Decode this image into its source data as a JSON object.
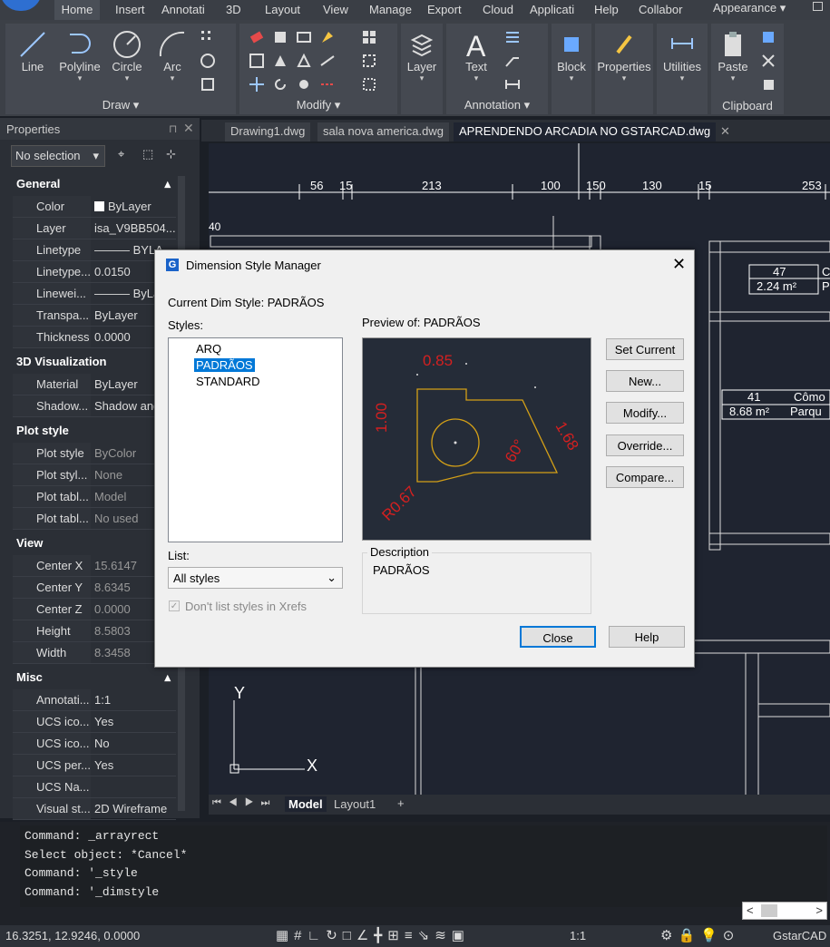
{
  "menu": {
    "tabs": [
      "Home",
      "Insert",
      "Annotati",
      "3D",
      "Layout",
      "View",
      "Manage",
      "Export",
      "Cloud",
      "Applicati",
      "Help",
      "Collabor"
    ],
    "appearance": "Appearance"
  },
  "ribbon": {
    "draw": {
      "title": "Draw",
      "buttons": [
        "Line",
        "Polyline",
        "Circle",
        "Arc"
      ]
    },
    "modify": {
      "title": "Modify"
    },
    "layer": "Layer",
    "annotation": {
      "title": "Annotation",
      "text": "Text"
    },
    "block": "Block",
    "properties": "Properties",
    "utilities": "Utilities",
    "clipboard": {
      "title": "Clipboard",
      "paste": "Paste"
    }
  },
  "properties": {
    "title": "Properties",
    "selection": "No selection",
    "sections": {
      "general": "General",
      "viz": "3D Visualization",
      "plot": "Plot style",
      "view": "View",
      "misc": "Misc"
    },
    "general": [
      {
        "k": "Color",
        "v": "ByLayer"
      },
      {
        "k": "Layer",
        "v": "isa_V9BB504..."
      },
      {
        "k": "Linetype",
        "v": "——— BYLA"
      },
      {
        "k": "Linetype...",
        "v": "0.0150"
      },
      {
        "k": "Linewei...",
        "v": "——— ByLa"
      },
      {
        "k": "Transpa...",
        "v": "ByLayer"
      },
      {
        "k": "Thickness",
        "v": "0.0000"
      }
    ],
    "viz": [
      {
        "k": "Material",
        "v": "ByLayer"
      },
      {
        "k": "Shadow...",
        "v": "Shadow and"
      }
    ],
    "plot": [
      {
        "k": "Plot style",
        "v": "ByColor"
      },
      {
        "k": "Plot styl...",
        "v": "None"
      },
      {
        "k": "Plot tabl...",
        "v": "Model"
      },
      {
        "k": "Plot tabl...",
        "v": "No used"
      }
    ],
    "view": [
      {
        "k": "Center X",
        "v": "15.6147"
      },
      {
        "k": "Center Y",
        "v": "8.6345"
      },
      {
        "k": "Center Z",
        "v": "0.0000"
      },
      {
        "k": "Height",
        "v": "8.5803"
      },
      {
        "k": "Width",
        "v": "8.3458"
      }
    ],
    "misc": [
      {
        "k": "Annotati...",
        "v": "1:1"
      },
      {
        "k": "UCS ico...",
        "v": "Yes"
      },
      {
        "k": "UCS ico...",
        "v": "No"
      },
      {
        "k": "UCS per...",
        "v": "Yes"
      },
      {
        "k": "UCS Na...",
        "v": ""
      },
      {
        "k": "Visual st...",
        "v": "2D Wireframe"
      }
    ]
  },
  "doc_tabs": [
    "Drawing1.dwg",
    "sala nova america.dwg",
    "APRENDENDO ARCADIA NO GSTARCAD.dwg"
  ],
  "drawing": {
    "dims": [
      "56",
      "15",
      "213",
      "100",
      "150",
      "130",
      "15",
      "253"
    ],
    "marker": "40",
    "rooms": [
      "47",
      "2.24 m²",
      "41",
      "8.68 m²",
      "Cômo",
      "Parqu"
    ]
  },
  "layout_tabs": [
    "Model",
    "Layout1",
    "+"
  ],
  "command_lines": [
    "Command: _arrayrect",
    "Select object: *Cancel*",
    "Command: '_style",
    "Command: '_dimstyle"
  ],
  "status": {
    "coords": "16.3251, 12.9246, 0.0000",
    "scale": "1:1",
    "app": "GstarCAD"
  },
  "dialog": {
    "title": "Dimension Style Manager",
    "current_label": "Current Dim Style: PADRÃOS",
    "styles_label": "Styles:",
    "styles": [
      "ARQ",
      "PADRÃOS",
      "STANDARD"
    ],
    "selected": "PADRÃOS",
    "preview_label": "Preview of: PADRÃOS",
    "preview_dims": [
      "0.85",
      "1.00",
      "60°",
      "1.68",
      "R0.67"
    ],
    "list_label": "List:",
    "list_value": "All styles",
    "xref_label": "Don't list styles in Xrefs",
    "desc_label": "Description",
    "desc_value": "PADRÃOS",
    "buttons": [
      "Set Current",
      "New...",
      "Modify...",
      "Override...",
      "Compare..."
    ],
    "close": "Close",
    "help": "Help"
  }
}
